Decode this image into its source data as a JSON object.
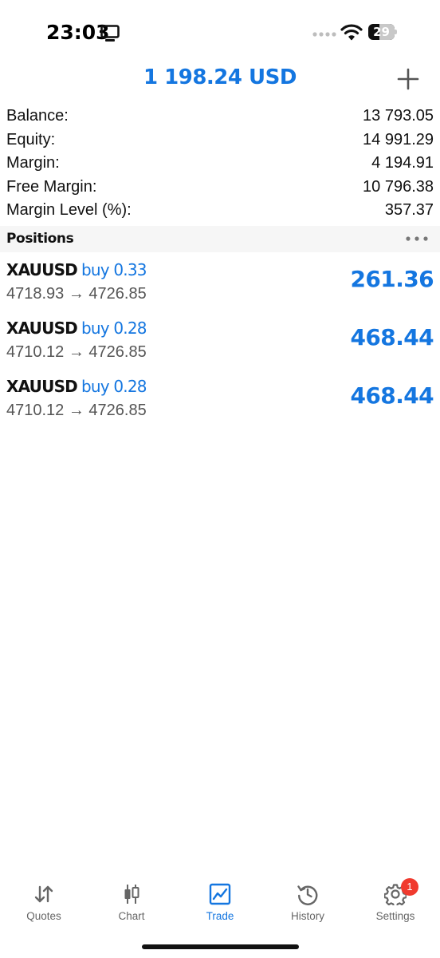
{
  "status_bar": {
    "time": "23:03",
    "battery_level": "29",
    "icons": [
      "monitor-icon",
      "cellular-signal-icon",
      "wifi-icon",
      "battery-icon"
    ]
  },
  "header": {
    "title": "1 198.24 USD",
    "add_icon": "plus-icon"
  },
  "summary": [
    {
      "label": "Balance:",
      "value": "13 793.05"
    },
    {
      "label": "Equity:",
      "value": "14 991.29"
    },
    {
      "label": "Margin:",
      "value": "4 194.91"
    },
    {
      "label": "Free Margin:",
      "value": "10 796.38"
    },
    {
      "label": "Margin Level (%):",
      "value": "357.37"
    }
  ],
  "positions": {
    "title": "Positions",
    "menu_icon": "more-dots-icon",
    "items": [
      {
        "symbol": "XAUUSD",
        "type": "buy 0.33",
        "prices": "4718.93 → 4726.85",
        "profit": "261.36"
      },
      {
        "symbol": "XAUUSD",
        "type": "buy 0.28",
        "prices": "4710.12 → 4726.85",
        "profit": "468.44"
      },
      {
        "symbol": "XAUUSD",
        "type": "buy 0.28",
        "prices": "4710.12 → 4726.85",
        "profit": "468.44"
      }
    ]
  },
  "tab_bar": {
    "tabs": [
      {
        "label": "Quotes",
        "icon": "quotes-arrows-icon",
        "active": false
      },
      {
        "label": "Chart",
        "icon": "candlestick-chart-icon",
        "active": false
      },
      {
        "label": "Trade",
        "icon": "trade-line-chart-icon",
        "active": true
      },
      {
        "label": "History",
        "icon": "history-clock-icon",
        "active": false
      },
      {
        "label": "Settings",
        "icon": "gear-icon",
        "active": false,
        "badge": "1"
      }
    ]
  },
  "colors": {
    "accent": "#1476e0",
    "text": "#111111",
    "secondary_text": "#555555",
    "section_bg": "#f6f6f6",
    "badge": "#f03a2e"
  }
}
